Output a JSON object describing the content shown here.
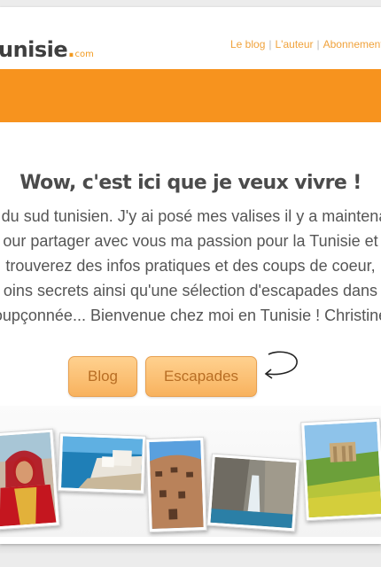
{
  "header": {
    "logo_main": "unisie",
    "logo_dot": ".",
    "logo_com": "com",
    "nav": {
      "blog": "Le blog",
      "author": "L'auteur",
      "subscribe": "Abonnement",
      "separator": "|"
    }
  },
  "banner": {
    "color": "#f7931e"
  },
  "main": {
    "headline": "Wow, c'est ici que je veux vivre !",
    "intro_lines": [
      "es du sud tunisien. J'y ai posé mes valises il y a maintenant",
      "our partager avec vous ma passion pour la Tunisie et",
      "trouverez des infos pratiques et des coups de coeur,",
      "oins secrets ainsi qu'une sélection d'escapades dans",
      "oupçonnée... Bienvenue chez moi en Tunisie ! Christine"
    ],
    "buttons": {
      "blog": "Blog",
      "escapades": "Escapades"
    }
  },
  "colors": {
    "accent": "#f7931e",
    "button_text": "#b86e24",
    "headline": "#4b4b4b"
  },
  "icons": {
    "arrow": "curved-arrow-icon"
  }
}
